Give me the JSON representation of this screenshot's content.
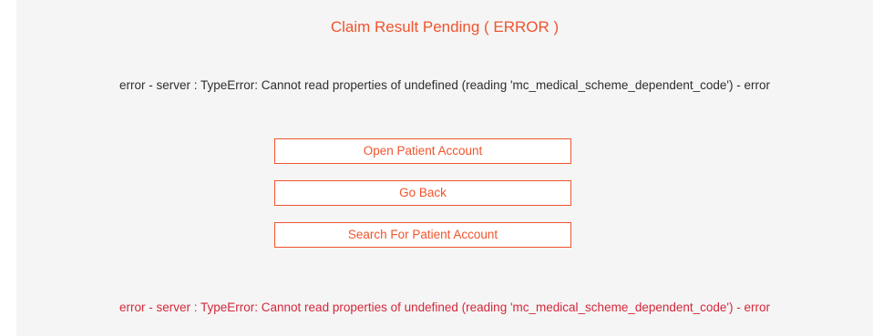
{
  "page": {
    "title": "Claim Result Pending ( ERROR )",
    "error_message_top": "error - server : TypeError: Cannot read properties of undefined (reading 'mc_medical_scheme_dependent_code') - error",
    "error_message_bottom": "error - server : TypeError: Cannot read properties of undefined (reading 'mc_medical_scheme_dependent_code') - error"
  },
  "buttons": {
    "open_patient_account": "Open Patient Account",
    "go_back": "Go Back",
    "search_for_patient_account": "Search For Patient Account"
  },
  "colors": {
    "accent": "#f0542d",
    "error_text": "#d3283a",
    "body_text": "#2e2e2e",
    "panel_background": "#f5f5f5"
  }
}
